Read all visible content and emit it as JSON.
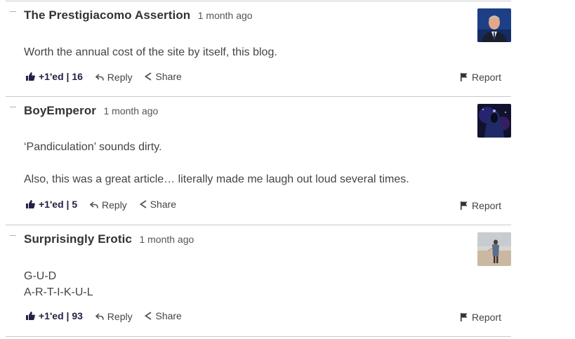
{
  "comments": [
    {
      "author": "The Prestigiacomo Assertion",
      "time": "1 month ago",
      "body": [
        "Worth the annual cost of the site by itself, this blog."
      ],
      "upvote": "+1'ed | 16",
      "reply": "Reply",
      "share": "Share",
      "report": "Report",
      "avatar_icon": "avatar-man-in-suit"
    },
    {
      "author": "BoyEmperor",
      "time": "1 month ago",
      "body": [
        "‘Pandiculation’ sounds dirty.",
        "Also, this was a great article… literally made me laugh out loud several times."
      ],
      "upvote": "+1'ed | 5",
      "reply": "Reply",
      "share": "Share",
      "report": "Report",
      "avatar_icon": "avatar-hooded-figure"
    },
    {
      "author": "Surprisingly Erotic",
      "time": "1 month ago",
      "body": [
        "G-U-D",
        "A-R-T-I-K-U-L"
      ],
      "upvote": "+1'ed | 93",
      "reply": "Reply",
      "share": "Share",
      "report": "Report",
      "avatar_icon": "avatar-beach-photo"
    }
  ],
  "colors": {
    "divider": "#c8c8c8",
    "upvote_text": "#222244",
    "text": "#444444"
  }
}
